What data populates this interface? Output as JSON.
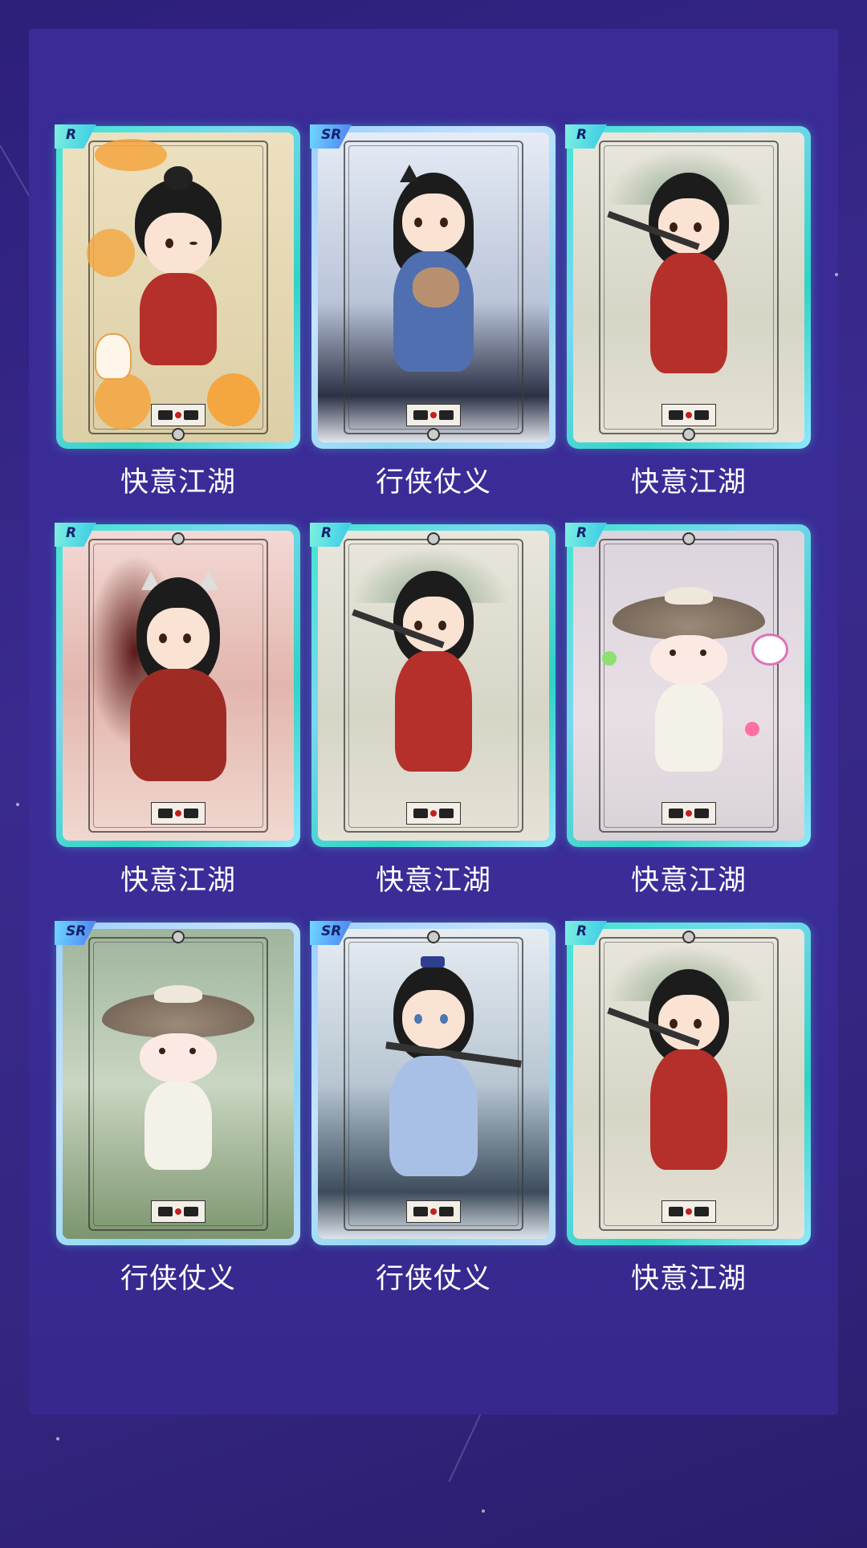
{
  "colors": {
    "background": "#33257f",
    "panel": "#3b2c98",
    "caption": "#ffffff",
    "card_frame_r": "#3fe6d0",
    "card_frame_sr": "#9ad0ff",
    "robe_red": "#b5302a",
    "robe_blue": "#4f6fb0"
  },
  "cards": [
    {
      "rarity": "R",
      "caption": "快意江湖",
      "art": "coin-hero-red",
      "icon": "lucky-cat-icon"
    },
    {
      "rarity": "SR",
      "caption": "行侠仗义",
      "art": "blue-robe-bear",
      "icon": "bear-plush-icon"
    },
    {
      "rarity": "R",
      "caption": "快意江湖",
      "art": "red-robe-sword",
      "icon": "sword-icon"
    },
    {
      "rarity": "R",
      "caption": "快意江湖",
      "art": "red-robe-fox-ears",
      "icon": "fox-ears-icon"
    },
    {
      "rarity": "R",
      "caption": "快意江湖",
      "art": "red-robe-sword",
      "icon": "sword-icon"
    },
    {
      "rarity": "R",
      "caption": "快意江湖",
      "art": "bamboo-hat-pink",
      "icon": "bamboo-hat-icon"
    },
    {
      "rarity": "SR",
      "caption": "行侠仗义",
      "art": "bamboo-hat-green",
      "icon": "bamboo-hat-icon"
    },
    {
      "rarity": "SR",
      "caption": "行侠仗义",
      "art": "light-blue-swordsman",
      "icon": "sword-icon"
    },
    {
      "rarity": "R",
      "caption": "快意江湖",
      "art": "red-robe-sword",
      "icon": "sword-icon"
    }
  ]
}
